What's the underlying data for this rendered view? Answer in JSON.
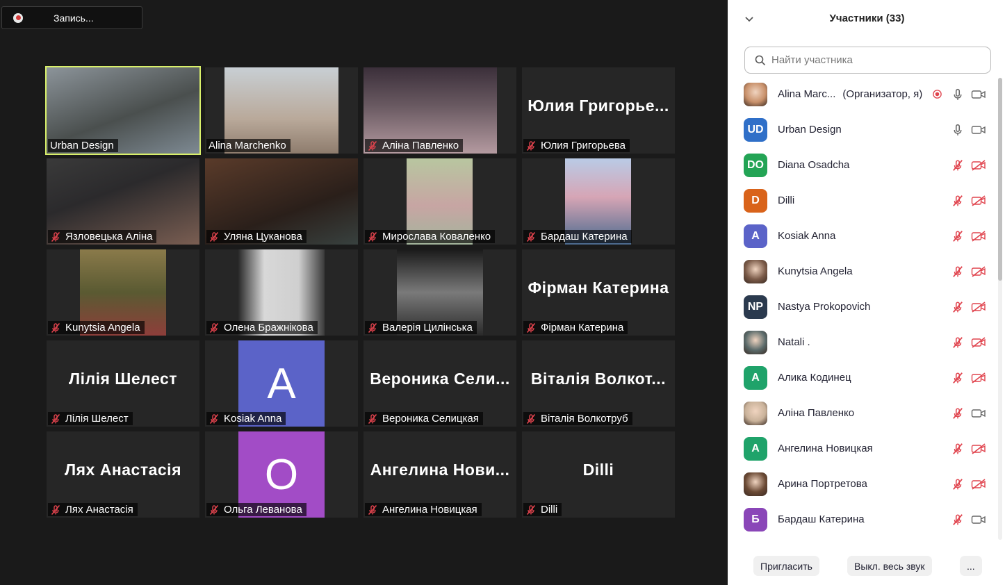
{
  "recording": {
    "label": "Запись..."
  },
  "tiles": [
    {
      "label": "Urban Design",
      "active": true,
      "muted": false,
      "type": "video"
    },
    {
      "label": "Alina Marchenko",
      "muted": false,
      "type": "video"
    },
    {
      "label": "Аліна Павленко",
      "muted": true,
      "type": "video"
    },
    {
      "label": "Юлия Григорьева",
      "muted": true,
      "type": "name",
      "display": "Юлия  Григорье..."
    },
    {
      "label": "Язловецька Аліна",
      "muted": true,
      "type": "video"
    },
    {
      "label": "Уляна Цуканова",
      "muted": true,
      "type": "video"
    },
    {
      "label": "Мирослава Коваленко",
      "muted": true,
      "type": "video"
    },
    {
      "label": "Бардаш Катерина",
      "muted": true,
      "type": "video"
    },
    {
      "label": "Kunytsia Angela",
      "muted": true,
      "type": "video"
    },
    {
      "label": "Олена Бражнікова",
      "muted": true,
      "type": "video"
    },
    {
      "label": "Валерія Цилінська",
      "muted": true,
      "type": "video"
    },
    {
      "label": "Фірман Катерина",
      "muted": true,
      "type": "name",
      "display": "Фірман  Катерина"
    },
    {
      "label": "Лілія Шелест",
      "muted": true,
      "type": "name",
      "display": "Лілія Шелест"
    },
    {
      "label": "Kosiak Anna",
      "muted": true,
      "type": "avatar",
      "display": "A",
      "color": "#5b63c8"
    },
    {
      "label": "Вероника Селицкая",
      "muted": true,
      "type": "name",
      "display": "Вероника  Сели..."
    },
    {
      "label": "Віталія Волкотруб",
      "muted": true,
      "type": "name",
      "display": "Віталія Волкот..."
    },
    {
      "label": "Лях Анастасія",
      "muted": true,
      "type": "name",
      "display": "Лях Анастасія"
    },
    {
      "label": "Ольга Леванова",
      "muted": true,
      "type": "avatar",
      "display": "О",
      "color": "#a24cc6"
    },
    {
      "label": "Ангелина Новицкая",
      "muted": true,
      "type": "name",
      "display": "Ангелина  Нови..."
    },
    {
      "label": "Dilli",
      "muted": true,
      "type": "name",
      "display": "Dilli"
    }
  ],
  "panel": {
    "title": "Участники (33)",
    "search_placeholder": "Найти участника",
    "participants": [
      {
        "name": "Alina Marc...",
        "role": "(Организатор, я)",
        "initials": "",
        "color": "#c8906a",
        "photo": true,
        "recording": true,
        "mic": "on",
        "cam": "off"
      },
      {
        "name": "Urban Design",
        "role": "",
        "initials": "UD",
        "color": "#2f6fc8",
        "photo": false,
        "mic": "on",
        "cam": "off"
      },
      {
        "name": "Diana Osadcha",
        "role": "",
        "initials": "DO",
        "color": "#23a455",
        "photo": false,
        "mic": "muted",
        "cam": "blocked"
      },
      {
        "name": "Dilli",
        "role": "",
        "initials": "D",
        "color": "#d9631a",
        "photo": false,
        "mic": "muted",
        "cam": "blocked"
      },
      {
        "name": "Kosiak Anna",
        "role": "",
        "initials": "A",
        "color": "#5b63c8",
        "photo": false,
        "mic": "muted",
        "cam": "blocked"
      },
      {
        "name": "Kunytsia Angela",
        "role": "",
        "initials": "",
        "color": "#7a5a48",
        "photo": true,
        "mic": "muted",
        "cam": "blocked"
      },
      {
        "name": "Nastya Prokopovich",
        "role": "",
        "initials": "NP",
        "color": "#2b3a4e",
        "photo": false,
        "mic": "muted",
        "cam": "blocked"
      },
      {
        "name": "Natali .",
        "role": "",
        "initials": "",
        "color": "#5a6a6a",
        "photo": true,
        "mic": "muted",
        "cam": "blocked"
      },
      {
        "name": "Алика Кодинец",
        "role": "",
        "initials": "А",
        "color": "#1fa36a",
        "photo": false,
        "mic": "muted",
        "cam": "blocked"
      },
      {
        "name": "Аліна Павленко",
        "role": "",
        "initials": "",
        "color": "#c9b29a",
        "photo": true,
        "mic": "muted",
        "cam": "off"
      },
      {
        "name": "Ангелина Новицкая",
        "role": "",
        "initials": "А",
        "color": "#1fa36a",
        "photo": false,
        "mic": "muted",
        "cam": "blocked"
      },
      {
        "name": "Арина Портретова",
        "role": "",
        "initials": "",
        "color": "#6b4a35",
        "photo": true,
        "mic": "muted",
        "cam": "blocked"
      },
      {
        "name": "Бардаш Катерина",
        "role": "",
        "initials": "Б",
        "color": "#8a46b8",
        "photo": false,
        "mic": "muted",
        "cam": "off"
      }
    ],
    "buttons": {
      "invite": "Пригласить",
      "mute_all": "Выкл. весь звук",
      "more": "..."
    }
  }
}
